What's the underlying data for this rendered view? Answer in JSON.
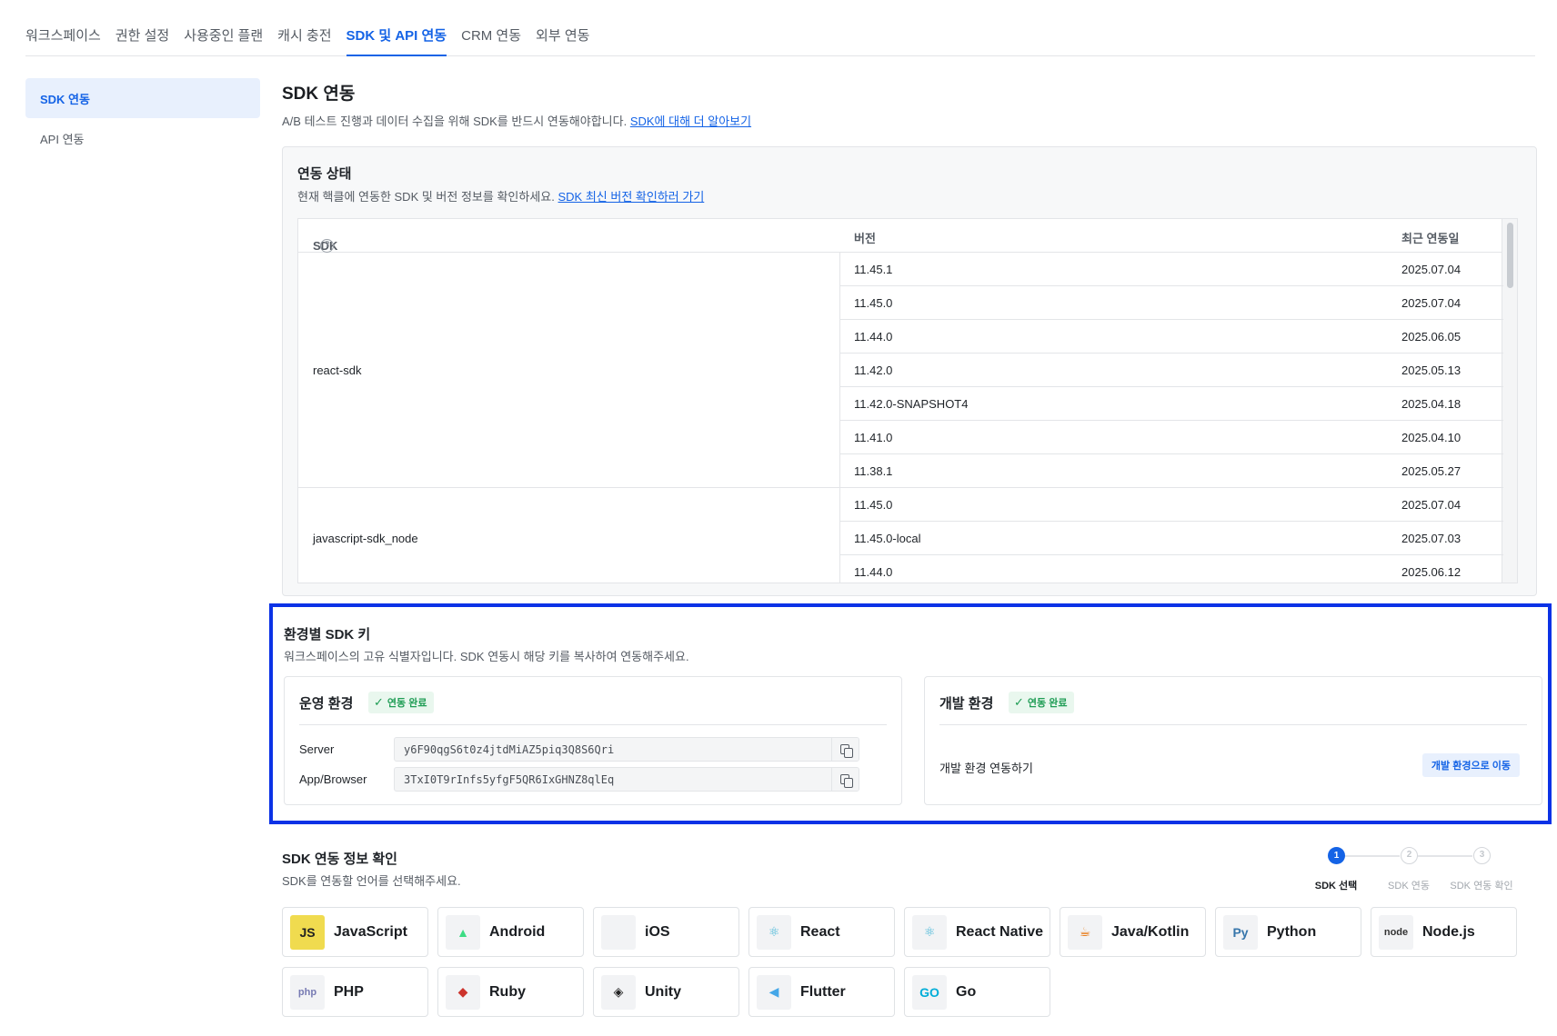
{
  "top_tabs": [
    "워크스페이스",
    "권한 설정",
    "사용중인 플랜",
    "캐시 충전",
    "SDK 및 API 연동",
    "CRM 연동",
    "외부 연동"
  ],
  "active_tab_index": 4,
  "sidebar": {
    "items": [
      "SDK 연동",
      "API 연동"
    ],
    "active_index": 0
  },
  "header": {
    "title": "SDK 연동",
    "description": "A/B 테스트 진행과 데이터 수집을 위해 SDK를 반드시 연동해야합니다.",
    "link": "SDK에 대해 더 알아보기"
  },
  "status": {
    "title": "연동 상태",
    "description": "현재 핵클에 연동한 SDK 및 버전 정보를 확인하세요.",
    "link": "SDK 최신 버전 확인하러 가기",
    "columns": {
      "sdk": "SDK",
      "help": "?",
      "version": "버전",
      "date": "최근 연동일"
    },
    "groups": [
      {
        "sdk": "react-sdk",
        "rows": [
          {
            "version": "11.45.1",
            "date": "2025.07.04"
          },
          {
            "version": "11.45.0",
            "date": "2025.07.04"
          },
          {
            "version": "11.44.0",
            "date": "2025.06.05"
          },
          {
            "version": "11.42.0",
            "date": "2025.05.13"
          },
          {
            "version": "11.42.0-SNAPSHOT4",
            "date": "2025.04.18"
          },
          {
            "version": "11.41.0",
            "date": "2025.04.10"
          },
          {
            "version": "11.38.1",
            "date": "2025.05.27"
          }
        ]
      },
      {
        "sdk": "javascript-sdk_node",
        "rows": [
          {
            "version": "11.45.0",
            "date": "2025.07.04"
          },
          {
            "version": "11.45.0-local",
            "date": "2025.07.03"
          },
          {
            "version": "11.44.0",
            "date": "2025.06.12"
          }
        ]
      }
    ]
  },
  "keys": {
    "title": "환경별 SDK 키",
    "description": "워크스페이스의 고유 식별자입니다. SDK 연동시 해당 키를 복사하여 연동해주세요.",
    "prod": {
      "title": "운영 환경",
      "badge": "연동 완료",
      "server_label": "Server",
      "server_key": "y6F90qgS6t0z4jtdMiAZ5piq3Q8S6Qri",
      "browser_label": "App/Browser",
      "browser_key": "3TxI0T9rInfs5yfgF5QR6IxGHNZ8qlEq"
    },
    "dev": {
      "title": "개발 환경",
      "badge": "연동 완료",
      "text": "개발 환경 연동하기",
      "button": "개발 환경으로 이동"
    }
  },
  "info": {
    "title": "SDK 연동 정보 확인",
    "description": "SDK를 연동할 언어를 선택해주세요.",
    "steps": [
      {
        "num": "1",
        "label": "SDK 선택"
      },
      {
        "num": "2",
        "label": "SDK 연동"
      },
      {
        "num": "3",
        "label": "SDK 연동 확인"
      }
    ],
    "active_step": 0,
    "languages": [
      {
        "name": "JavaScript",
        "icon": "javascript-icon",
        "glyph": "JS",
        "color": "#f0db4f",
        "fg": "#222222"
      },
      {
        "name": "Android",
        "icon": "android-icon",
        "glyph": "▲",
        "color": "#f2f3f5",
        "fg": "#3ddc84"
      },
      {
        "name": "iOS",
        "icon": "apple-icon",
        "glyph": "",
        "color": "#f2f3f5",
        "fg": "#888888"
      },
      {
        "name": "React",
        "icon": "react-icon",
        "glyph": "⚛",
        "color": "#f2f3f5",
        "fg": "#3bb3d6"
      },
      {
        "name": "React Native",
        "icon": "react-native-icon",
        "glyph": "⚛",
        "color": "#f2f3f5",
        "fg": "#3bb3d6"
      },
      {
        "name": "Java/Kotlin",
        "icon": "java-icon",
        "glyph": "☕",
        "color": "#f2f3f5",
        "fg": "#e76f00"
      },
      {
        "name": "Python",
        "icon": "python-icon",
        "glyph": "Py",
        "color": "#f2f3f5",
        "fg": "#3776ab"
      },
      {
        "name": "Node.js",
        "icon": "nodejs-icon",
        "glyph": "node",
        "color": "#f2f3f5",
        "fg": "#333333"
      },
      {
        "name": "PHP",
        "icon": "php-icon",
        "glyph": "php",
        "color": "#f2f3f5",
        "fg": "#777bb3"
      },
      {
        "name": "Ruby",
        "icon": "ruby-icon",
        "glyph": "◆",
        "color": "#f2f3f5",
        "fg": "#cc342d"
      },
      {
        "name": "Unity",
        "icon": "unity-icon",
        "glyph": "◈",
        "color": "#f2f3f5",
        "fg": "#222222"
      },
      {
        "name": "Flutter",
        "icon": "flutter-icon",
        "glyph": "◀",
        "color": "#f2f3f5",
        "fg": "#45a7e8"
      },
      {
        "name": "Go",
        "icon": "go-icon",
        "glyph": "GO",
        "color": "#f2f3f5",
        "fg": "#00add8"
      }
    ]
  }
}
